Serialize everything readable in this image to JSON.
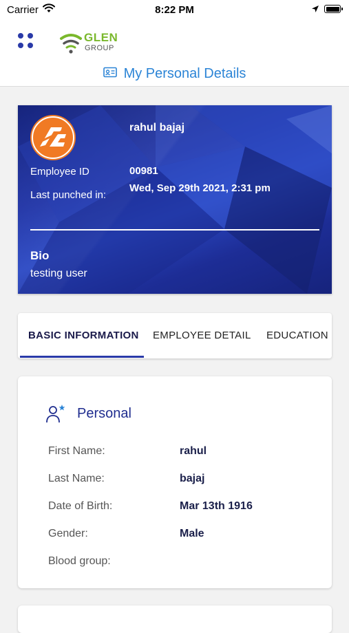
{
  "status_bar": {
    "carrier": "Carrier",
    "time": "8:22 PM"
  },
  "header": {
    "logo_line1": "GLEN",
    "logo_line2": "GROUP",
    "page_title": "My Personal Details"
  },
  "profile": {
    "name": "rahul bajaj",
    "employee_id_label": "Employee ID",
    "employee_id": "00981",
    "last_punched_label": "Last punched in:",
    "last_punched": "Wed, Sep 29th 2021, 2:31 pm",
    "bio_label": "Bio",
    "bio": "testing user"
  },
  "tabs": [
    {
      "label": "BASIC INFORMATION",
      "active": true
    },
    {
      "label": "EMPLOYEE DETAIL",
      "active": false
    },
    {
      "label": "EDUCATION",
      "active": false
    }
  ],
  "personal": {
    "title": "Personal",
    "rows": [
      {
        "label": "First Name:",
        "value": "rahul"
      },
      {
        "label": "Last Name:",
        "value": "bajaj"
      },
      {
        "label": "Date of Birth:",
        "value": "Mar 13th 1916"
      },
      {
        "label": "Gender:",
        "value": "Male"
      },
      {
        "label": "Blood group:",
        "value": ""
      }
    ]
  },
  "colors": {
    "accent": "#2a3aa8",
    "title_blue": "#2b84d6",
    "logo_green": "#7ab82c",
    "avatar_orange": "#f07a24"
  },
  "icons": {
    "menu": "grid-dots-icon",
    "title": "id-card-icon",
    "section": "person-star-icon",
    "wifi": "wifi-icon",
    "location": "location-arrow-icon",
    "battery": "battery-icon"
  }
}
